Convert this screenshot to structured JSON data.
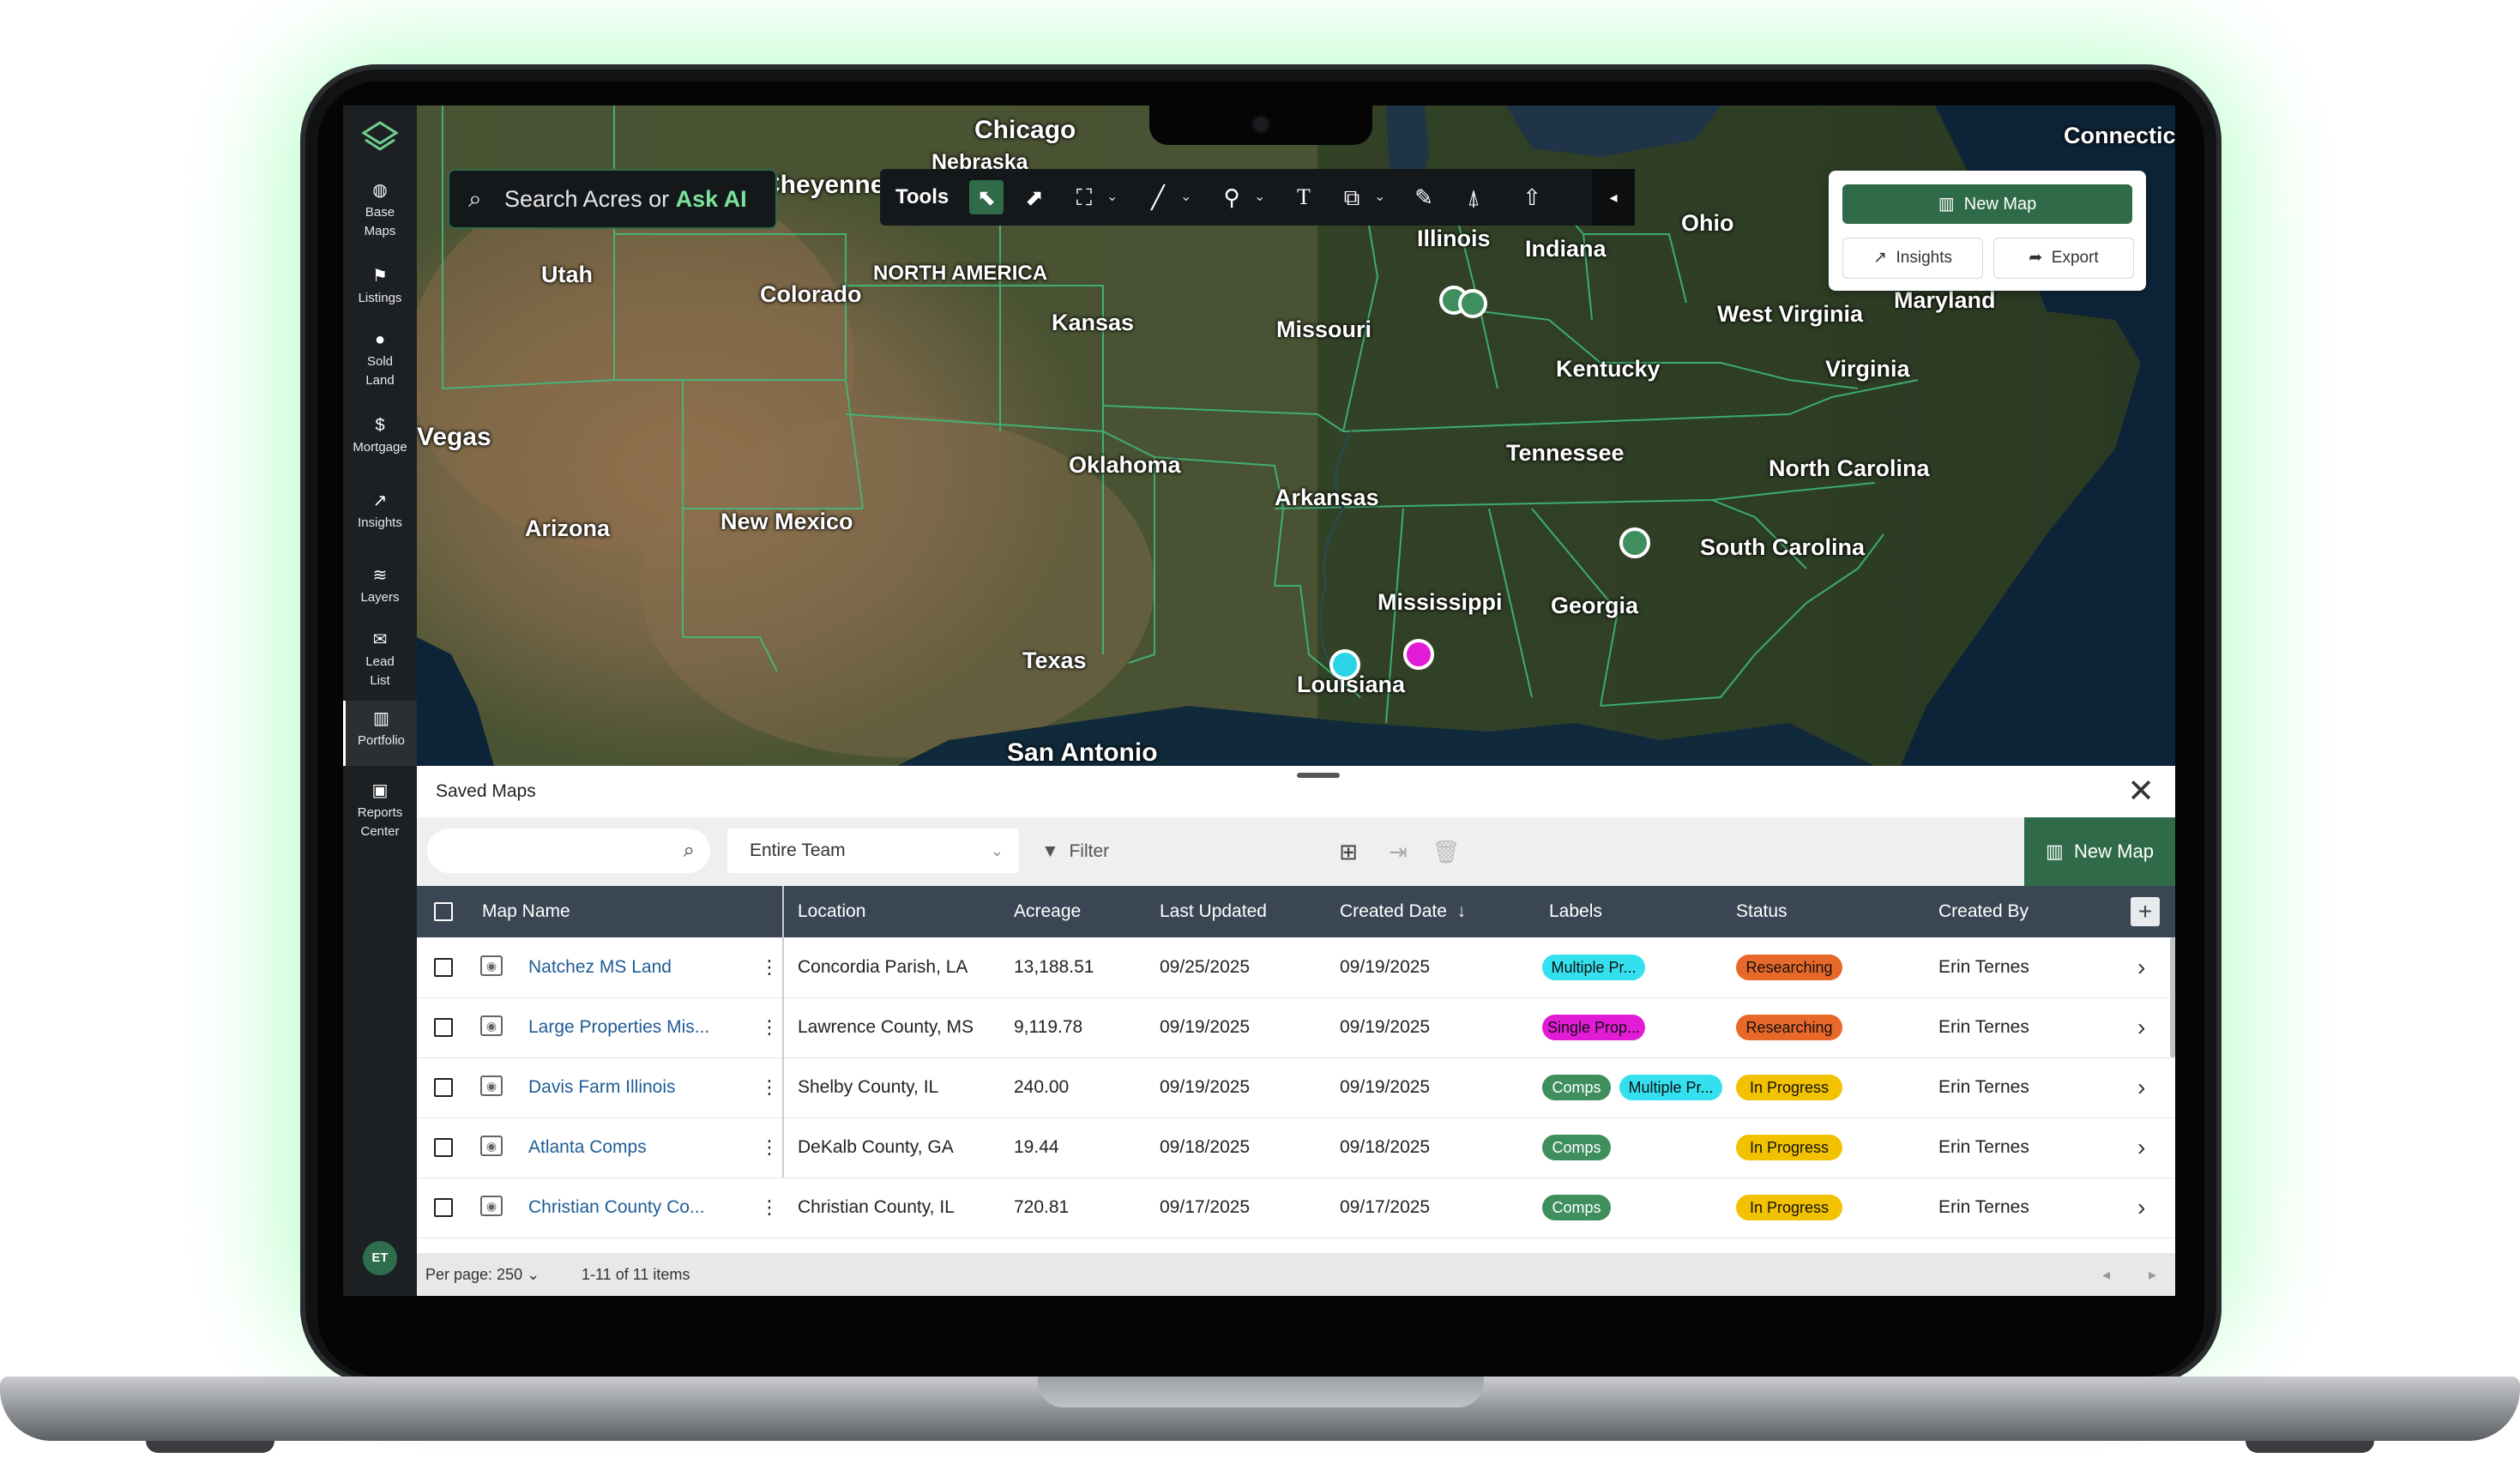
{
  "sidebar": {
    "items": [
      {
        "label": "Base\nMaps",
        "l1": "Base",
        "l2": "Maps",
        "icon": "globe-icon"
      },
      {
        "label": "Listings",
        "l1": "Listings",
        "l2": "",
        "icon": "flag-icon"
      },
      {
        "label": "Sold Land",
        "l1": "Sold",
        "l2": "Land",
        "icon": "pin-icon"
      },
      {
        "label": "Mortgage",
        "l1": "Mortgage",
        "l2": "",
        "icon": "dollar-icon"
      },
      {
        "label": "Insights",
        "l1": "Insights",
        "l2": "",
        "icon": "trend-icon"
      },
      {
        "label": "Layers",
        "l1": "Layers",
        "l2": "",
        "icon": "layers-icon"
      },
      {
        "label": "Lead List",
        "l1": "Lead",
        "l2": "List",
        "icon": "mail-icon"
      },
      {
        "label": "Portfolio",
        "l1": "Portfolio",
        "l2": "",
        "icon": "map-icon"
      },
      {
        "label": "Reports Center",
        "l1": "Reports",
        "l2": "Center",
        "icon": "briefcase-icon"
      }
    ],
    "avatar": "ET"
  },
  "search": {
    "prefix": "Search Acres or ",
    "ai": "Ask AI"
  },
  "tools": {
    "label": "Tools"
  },
  "map_panel": {
    "new_map": "New Map",
    "insights": "Insights",
    "export": "Export"
  },
  "map_labels": {
    "chicago": "Chicago",
    "connecticut": "Connecticut",
    "nebraska": "Nebraska",
    "cheyenne": "Cheyenne",
    "utah": "Utah",
    "colorado": "Colorado",
    "north_america": "NORTH AMERICA",
    "kansas": "Kansas",
    "missouri": "Missouri",
    "illinois": "Illinois",
    "indiana": "Indiana",
    "ohio": "Ohio",
    "west_virginia": "West Virginia",
    "maryland": "Maryland",
    "kentucky": "Kentucky",
    "virginia": "Virginia",
    "vegas": "Vegas",
    "oklahoma": "Oklahoma",
    "tennessee": "Tennessee",
    "north_carolina": "North Carolina",
    "arizona": "Arizona",
    "new_mexico": "New Mexico",
    "arkansas": "Arkansas",
    "south_carolina": "South Carolina",
    "mississippi": "Mississippi",
    "georgia": "Georgia",
    "texas": "Texas",
    "louisiana": "Louisiana",
    "san_antonio": "San Antonio"
  },
  "colors": {
    "accent": "#2f6b49",
    "marker_green": "#3e8e5e",
    "marker_cyan": "#2ad4e6",
    "marker_magenta": "#e21bd6"
  },
  "saved_maps": {
    "title": "Saved Maps",
    "team_filter": "Entire Team",
    "filter_label": "Filter",
    "new_map": "New Map",
    "columns": [
      "Map Name",
      "Location",
      "Acreage",
      "Last Updated",
      "Created Date",
      "Labels",
      "Status",
      "Created By"
    ],
    "rows": [
      {
        "name": "Natchez MS Land",
        "location": "Concordia Parish, LA",
        "acreage": "13,188.51",
        "updated": "09/25/2025",
        "created": "09/19/2025",
        "labels": [
          "Multiple Pr..."
        ],
        "status": "Researching",
        "by": "Erin Ternes"
      },
      {
        "name": "Large Properties Mis...",
        "location": "Lawrence County, MS",
        "acreage": "9,119.78",
        "updated": "09/19/2025",
        "created": "09/19/2025",
        "labels": [
          "Single Prop..."
        ],
        "status": "Researching",
        "by": "Erin Ternes"
      },
      {
        "name": "Davis Farm Illinois",
        "location": "Shelby County, IL",
        "acreage": "240.00",
        "updated": "09/19/2025",
        "created": "09/19/2025",
        "labels": [
          "Comps",
          "Multiple Pr..."
        ],
        "status": "In Progress",
        "by": "Erin Ternes"
      },
      {
        "name": "Atlanta Comps",
        "location": "DeKalb County, GA",
        "acreage": "19.44",
        "updated": "09/18/2025",
        "created": "09/18/2025",
        "labels": [
          "Comps"
        ],
        "status": "In Progress",
        "by": "Erin Ternes"
      },
      {
        "name": "Christian County Co...",
        "location": "Christian County, IL",
        "acreage": "720.81",
        "updated": "09/17/2025",
        "created": "09/17/2025",
        "labels": [
          "Comps"
        ],
        "status": "In Progress",
        "by": "Erin Ternes"
      }
    ],
    "per_page": "Per page: 250",
    "range": "1-11 of 11 items"
  }
}
